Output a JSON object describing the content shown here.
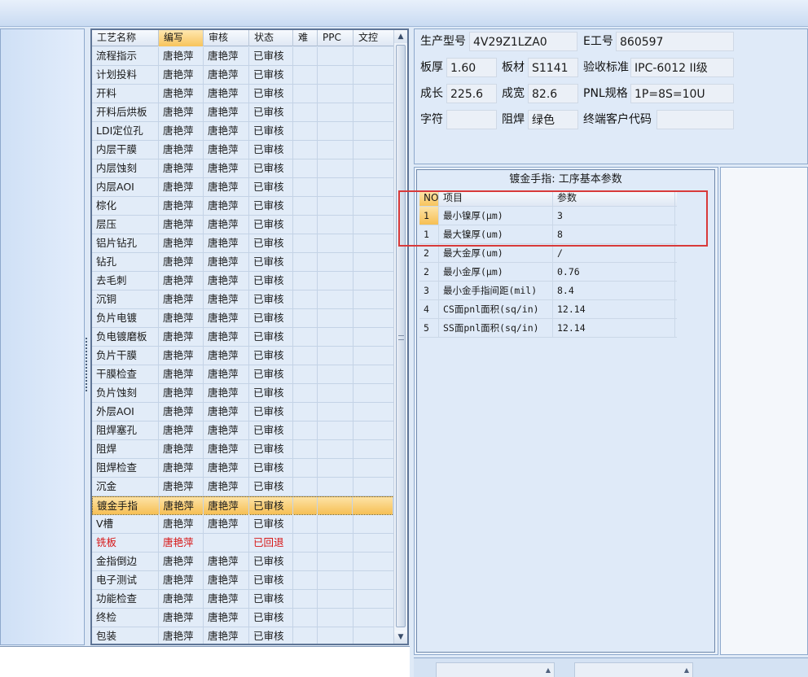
{
  "process_grid": {
    "columns": [
      "工艺名称",
      "编写",
      "审核",
      "状态",
      "难",
      "PPC",
      "文控"
    ],
    "rows": [
      {
        "name": "流程指示",
        "writer": "唐艳萍",
        "reviewer": "唐艳萍",
        "status": "已审核"
      },
      {
        "name": "计划投料",
        "writer": "唐艳萍",
        "reviewer": "唐艳萍",
        "status": "已审核"
      },
      {
        "name": "开料",
        "writer": "唐艳萍",
        "reviewer": "唐艳萍",
        "status": "已审核"
      },
      {
        "name": "开料后烘板",
        "writer": "唐艳萍",
        "reviewer": "唐艳萍",
        "status": "已审核"
      },
      {
        "name": "LDI定位孔",
        "writer": "唐艳萍",
        "reviewer": "唐艳萍",
        "status": "已审核"
      },
      {
        "name": "内层干膜",
        "writer": "唐艳萍",
        "reviewer": "唐艳萍",
        "status": "已审核"
      },
      {
        "name": "内层蚀刻",
        "writer": "唐艳萍",
        "reviewer": "唐艳萍",
        "status": "已审核"
      },
      {
        "name": "内层AOI",
        "writer": "唐艳萍",
        "reviewer": "唐艳萍",
        "status": "已审核"
      },
      {
        "name": "棕化",
        "writer": "唐艳萍",
        "reviewer": "唐艳萍",
        "status": "已审核"
      },
      {
        "name": "层压",
        "writer": "唐艳萍",
        "reviewer": "唐艳萍",
        "status": "已审核"
      },
      {
        "name": "铝片钻孔",
        "writer": "唐艳萍",
        "reviewer": "唐艳萍",
        "status": "已审核"
      },
      {
        "name": "钻孔",
        "writer": "唐艳萍",
        "reviewer": "唐艳萍",
        "status": "已审核"
      },
      {
        "name": "去毛刺",
        "writer": "唐艳萍",
        "reviewer": "唐艳萍",
        "status": "已审核"
      },
      {
        "name": "沉铜",
        "writer": "唐艳萍",
        "reviewer": "唐艳萍",
        "status": "已审核"
      },
      {
        "name": "负片电镀",
        "writer": "唐艳萍",
        "reviewer": "唐艳萍",
        "status": "已审核"
      },
      {
        "name": "负电镀磨板",
        "writer": "唐艳萍",
        "reviewer": "唐艳萍",
        "status": "已审核"
      },
      {
        "name": "负片干膜",
        "writer": "唐艳萍",
        "reviewer": "唐艳萍",
        "status": "已审核"
      },
      {
        "name": "干膜检查",
        "writer": "唐艳萍",
        "reviewer": "唐艳萍",
        "status": "已审核"
      },
      {
        "name": "负片蚀刻",
        "writer": "唐艳萍",
        "reviewer": "唐艳萍",
        "status": "已审核"
      },
      {
        "name": "外层AOI",
        "writer": "唐艳萍",
        "reviewer": "唐艳萍",
        "status": "已审核"
      },
      {
        "name": "阻焊塞孔",
        "writer": "唐艳萍",
        "reviewer": "唐艳萍",
        "status": "已审核"
      },
      {
        "name": "阻焊",
        "writer": "唐艳萍",
        "reviewer": "唐艳萍",
        "status": "已审核"
      },
      {
        "name": "阻焊检查",
        "writer": "唐艳萍",
        "reviewer": "唐艳萍",
        "status": "已审核"
      },
      {
        "name": "沉金",
        "writer": "唐艳萍",
        "reviewer": "唐艳萍",
        "status": "已审核"
      },
      {
        "name": "镀金手指",
        "writer": "唐艳萍",
        "reviewer": "唐艳萍",
        "status": "已审核",
        "selected": true
      },
      {
        "name": "V槽",
        "writer": "唐艳萍",
        "reviewer": "唐艳萍",
        "status": "已审核"
      },
      {
        "name": "铣板",
        "writer": "唐艳萍",
        "reviewer": "",
        "status": "已回退",
        "returned": true
      },
      {
        "name": "金指倒边",
        "writer": "唐艳萍",
        "reviewer": "唐艳萍",
        "status": "已审核"
      },
      {
        "name": "电子测试",
        "writer": "唐艳萍",
        "reviewer": "唐艳萍",
        "status": "已审核"
      },
      {
        "name": "功能检查",
        "writer": "唐艳萍",
        "reviewer": "唐艳萍",
        "status": "已审核"
      },
      {
        "name": "终检",
        "writer": "唐艳萍",
        "reviewer": "唐艳萍",
        "status": "已审核"
      },
      {
        "name": "包装",
        "writer": "唐艳萍",
        "reviewer": "唐艳萍",
        "status": "已审核"
      }
    ]
  },
  "info": {
    "model_label": "生产型号",
    "model_value": "4V29Z1LZA0",
    "ejob_label": "E工号",
    "ejob_value": "860597",
    "thickness_label": "板厚",
    "thickness_value": "1.60",
    "material_label": "板材",
    "material_value": "S1141",
    "standard_label": "验收标准",
    "standard_value": "IPC-6012 II级",
    "length_label": "成长",
    "length_value": "225.6",
    "width_label": "成宽",
    "width_value": "82.6",
    "pnl_label": "PNL规格",
    "pnl_value": "1P=8S=10U",
    "legend_label": "字符",
    "legend_value": "",
    "mask_label": "阻焊",
    "mask_value": "绿色",
    "customer_label": "终端客户代码",
    "customer_value": ""
  },
  "params": {
    "title": "镀金手指: 工序基本参数",
    "columns": [
      "NO",
      "项目",
      "参数"
    ],
    "rows": [
      {
        "no": "1",
        "item": "最小镍厚(μm)",
        "value": "3",
        "selected": true
      },
      {
        "no": "1",
        "item": "最大镍厚(um)",
        "value": "8"
      },
      {
        "no": "2",
        "item": "最大金厚(um)",
        "value": "/"
      },
      {
        "no": "2",
        "item": "最小金厚(μm)",
        "value": "0.76"
      },
      {
        "no": "3",
        "item": "最小金手指间距(mil)",
        "value": "8.4"
      },
      {
        "no": "4",
        "item": "CS面pnl面积(sq/in)",
        "value": "12.14"
      },
      {
        "no": "5",
        "item": "SS面pnl面积(sq/in)",
        "value": "12.14"
      }
    ]
  },
  "icons": {
    "scroll_up": "scroll-up-icon",
    "scroll_down": "scroll-down-icon",
    "splitter_grip": "splitter-grip-icon"
  },
  "colors": {
    "selected_row": "#f6bf54",
    "returned_text": "#d71616",
    "highlight_border": "#d83a3a"
  }
}
